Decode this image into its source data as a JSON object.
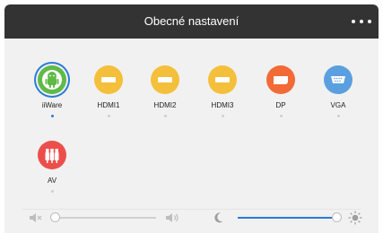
{
  "header": {
    "title": "Obecné nastavení",
    "menu_icon": "more-dots-icon"
  },
  "sources": [
    {
      "label": "iiWare",
      "icon": "android-robot-icon",
      "color": "#5fba47",
      "selected": true
    },
    {
      "label": "HDMI1",
      "icon": "hdmi-port-icon",
      "color": "#f4bf3a",
      "selected": false
    },
    {
      "label": "HDMI2",
      "icon": "hdmi-port-icon",
      "color": "#f4bf3a",
      "selected": false
    },
    {
      "label": "HDMI3",
      "icon": "hdmi-port-icon",
      "color": "#f4bf3a",
      "selected": false
    },
    {
      "label": "DP",
      "icon": "displayport-icon",
      "color": "#f26a36",
      "selected": false
    },
    {
      "label": "VGA",
      "icon": "vga-port-icon",
      "color": "#5a9fe0",
      "selected": false
    },
    {
      "label": "AV",
      "icon": "av-rca-icon",
      "color": "#ec4e4b",
      "selected": false
    }
  ],
  "volume": {
    "level": 0,
    "min_icon": "speaker-mute-icon",
    "max_icon": "speaker-loud-icon"
  },
  "brightness": {
    "level": 1.0,
    "min_icon": "moon-icon",
    "max_icon": "sun-icon",
    "accent": "#2a7bd6"
  }
}
